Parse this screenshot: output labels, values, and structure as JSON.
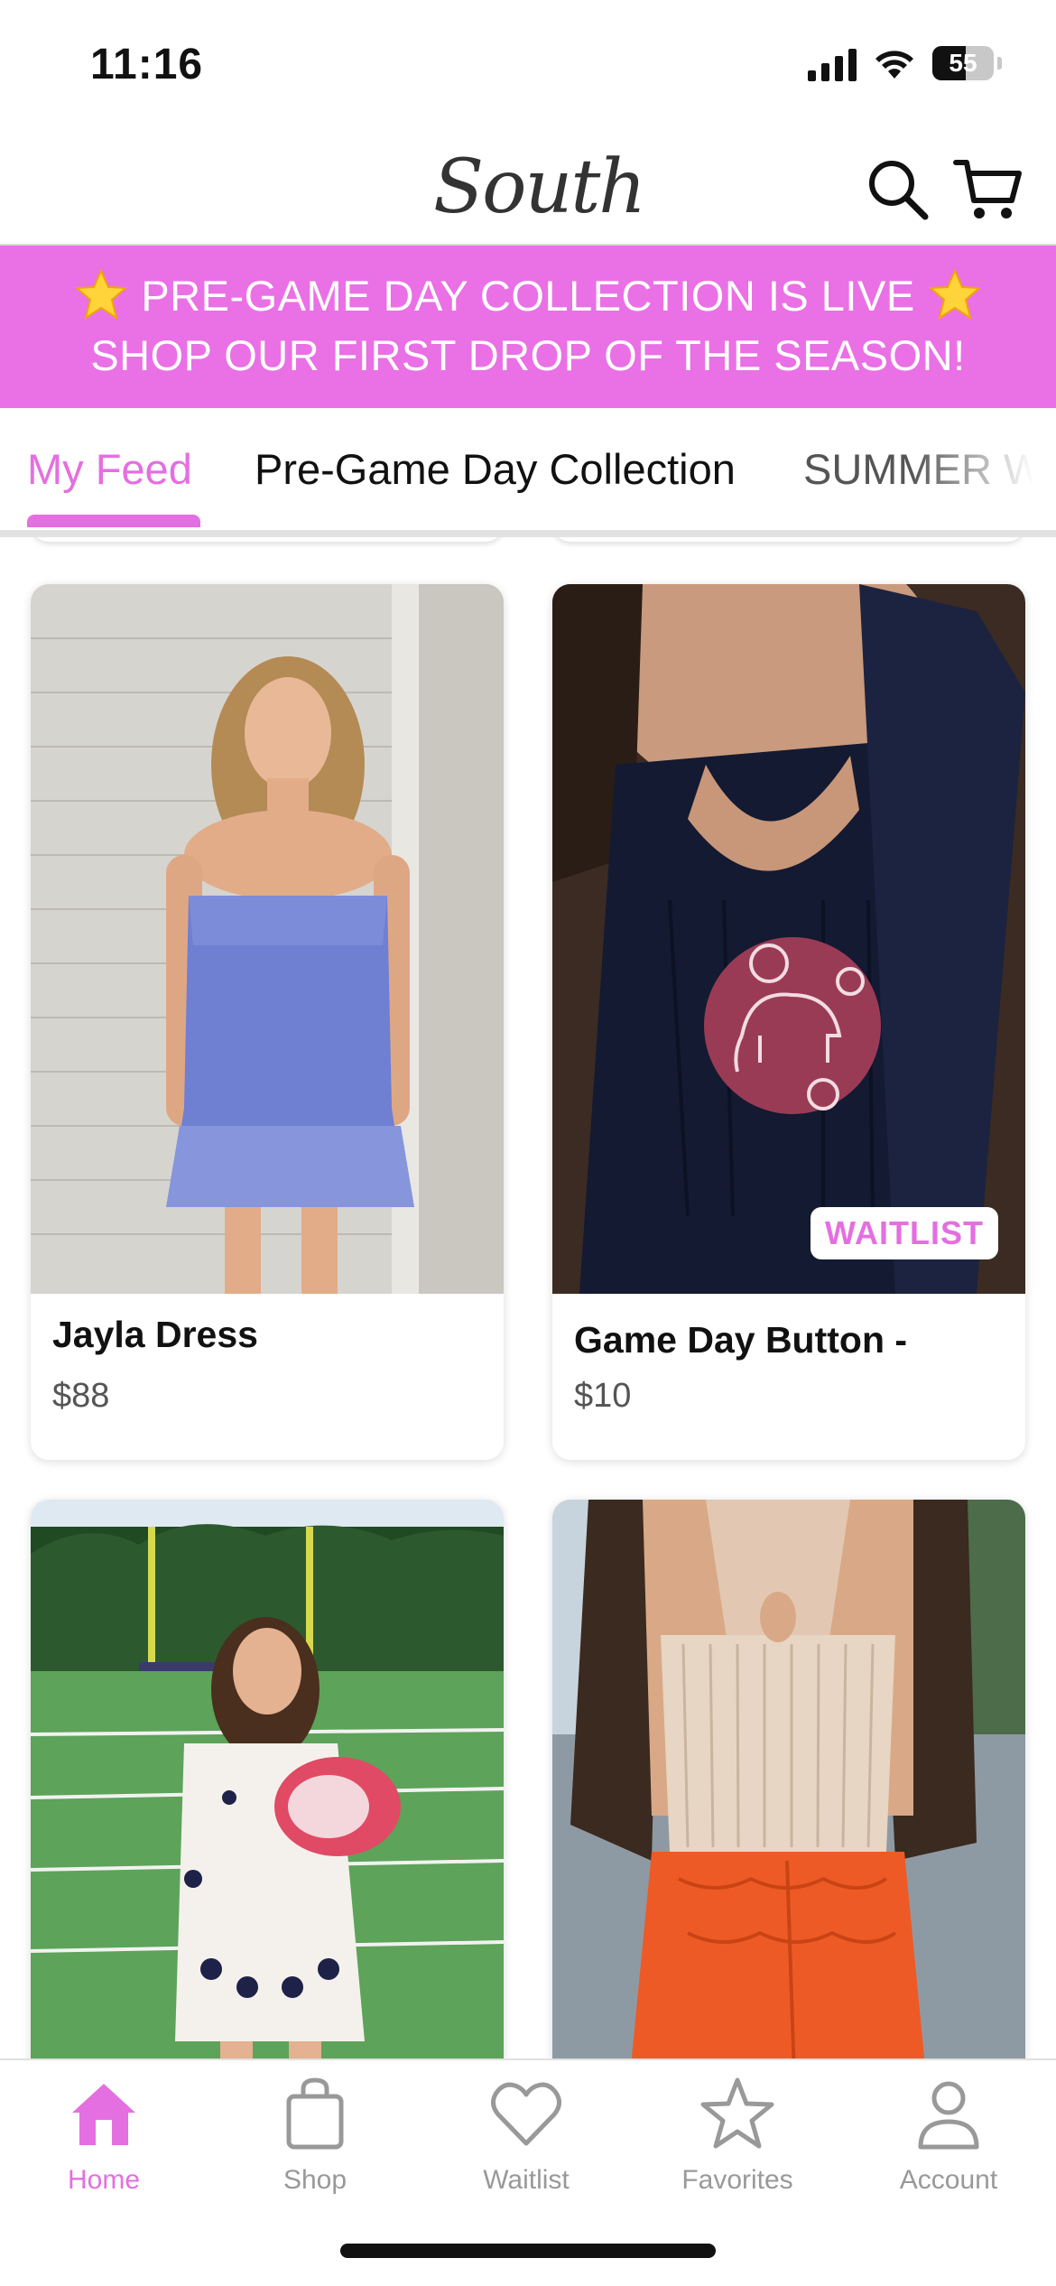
{
  "status_bar": {
    "time": "11:16",
    "battery": "55",
    "icons": [
      "cellular-signal-icon",
      "wifi-icon",
      "battery-icon"
    ]
  },
  "header": {
    "logo": "South",
    "icons": [
      "search-icon",
      "cart-icon"
    ]
  },
  "promo": {
    "line1": "PRE-GAME DAY COLLECTION IS LIVE",
    "line2": "SHOP OUR FIRST DROP OF THE SEASON!",
    "icon": "star-emoji",
    "background": "#ea70e5"
  },
  "tabs": [
    {
      "label": "My Feed",
      "active": true
    },
    {
      "label": "Pre-Game Day Collection",
      "active": false
    },
    {
      "label": "SUMMER W",
      "active": false
    }
  ],
  "products": [
    {
      "title": "Jayla Dress",
      "price": "$88",
      "badge": ""
    },
    {
      "title": "Game Day Button -",
      "price": "$10",
      "badge": "WAITLIST"
    },
    {
      "title": "",
      "price": "",
      "badge": ""
    },
    {
      "title": "",
      "price": "",
      "badge": ""
    }
  ],
  "bottom_nav": [
    {
      "label": "Home",
      "icon": "home-icon",
      "active": true
    },
    {
      "label": "Shop",
      "icon": "shopping-bag-icon",
      "active": false
    },
    {
      "label": "Waitlist",
      "icon": "heart-icon",
      "active": false
    },
    {
      "label": "Favorites",
      "icon": "star-icon",
      "active": false
    },
    {
      "label": "Account",
      "icon": "user-icon",
      "active": false
    }
  ],
  "colors": {
    "accent": "#e46fe0",
    "promo_bg": "#ea70e5",
    "inactive_nav": "#999999"
  }
}
